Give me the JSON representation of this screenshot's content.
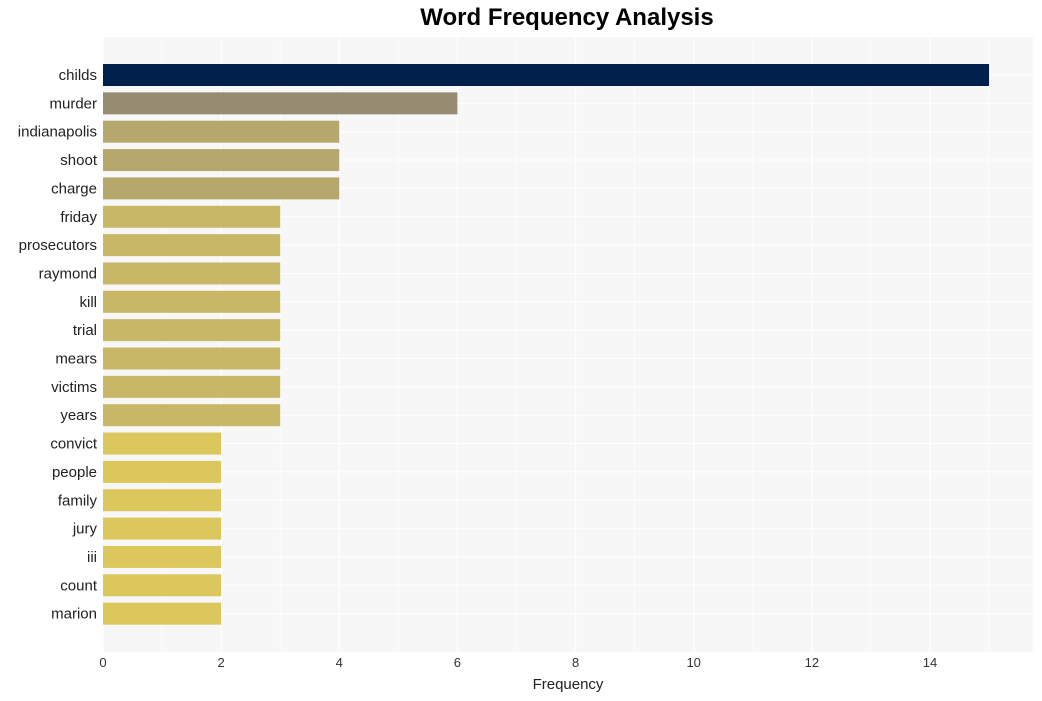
{
  "chart_data": {
    "type": "bar",
    "orientation": "horizontal",
    "title": "Word Frequency Analysis",
    "xlabel": "Frequency",
    "ylabel": "",
    "xlim": [
      0,
      15.7
    ],
    "xticks": [
      0,
      2,
      4,
      6,
      8,
      10,
      12,
      14
    ],
    "grid": true,
    "categories": [
      "childs",
      "murder",
      "indianapolis",
      "shoot",
      "charge",
      "friday",
      "prosecutors",
      "raymond",
      "kill",
      "trial",
      "mears",
      "victims",
      "years",
      "convict",
      "people",
      "family",
      "jury",
      "iii",
      "count",
      "marion"
    ],
    "values": [
      15,
      6,
      4,
      4,
      4,
      3,
      3,
      3,
      3,
      3,
      3,
      3,
      3,
      2,
      2,
      2,
      2,
      2,
      2,
      2
    ],
    "colors": [
      "#00204c",
      "#958c72",
      "#b6a86c",
      "#b6a86c",
      "#b6a86c",
      "#c8b767",
      "#c8b767",
      "#c8b767",
      "#c8b767",
      "#c8b767",
      "#c8b767",
      "#c8b767",
      "#c8b767",
      "#dcc75c",
      "#dcc75c",
      "#dcc75c",
      "#dcc75c",
      "#dcc75c",
      "#dcc75c",
      "#dcc75c"
    ]
  }
}
